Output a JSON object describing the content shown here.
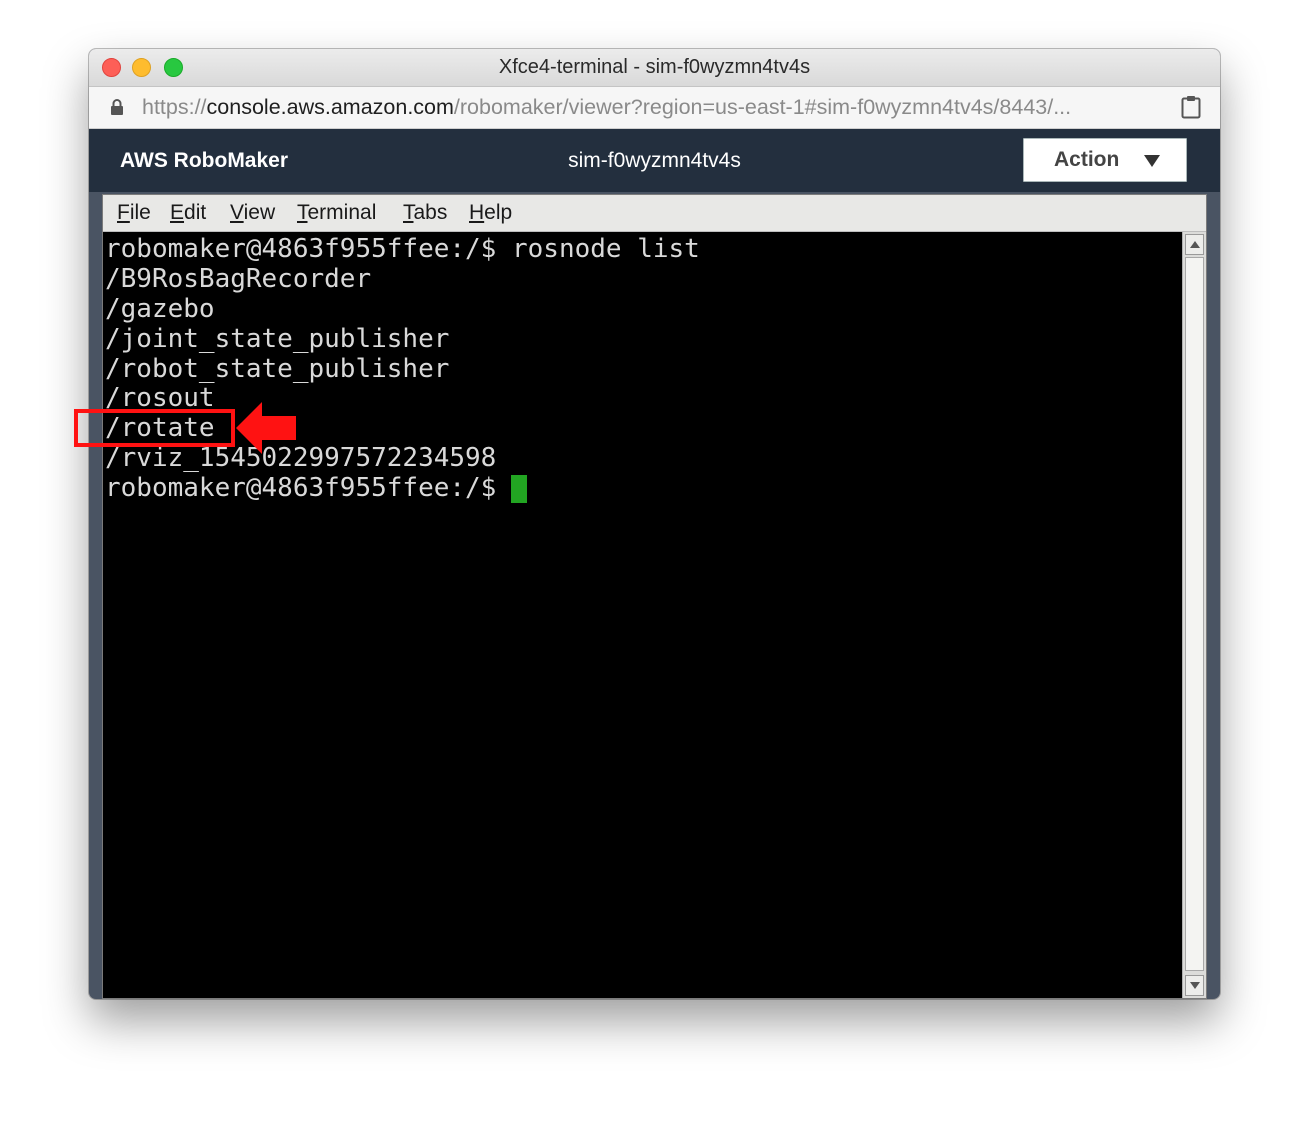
{
  "window": {
    "title": "Xfce4-terminal - sim-f0wyzmn4tv4s"
  },
  "address_bar": {
    "url_scheme": "https://",
    "url_host": "console.aws.amazon.com",
    "url_path": "/robomaker/viewer?region=us-east-1#sim-f0wyzmn4tv4s/8443/...",
    "icons": [
      "lock-icon",
      "clipboard-icon"
    ]
  },
  "app_header": {
    "brand": "AWS RoboMaker",
    "simulation_id": "sim-f0wyzmn4tv4s",
    "action_button": "Action",
    "action_caret_icon": "caret-down-icon"
  },
  "menubar": {
    "items": [
      {
        "first": "F",
        "rest": "ile"
      },
      {
        "first": "E",
        "rest": "dit"
      },
      {
        "first": "V",
        "rest": "iew"
      },
      {
        "first": "T",
        "rest": "erminal"
      },
      {
        "first": "T",
        "rest": "abs"
      },
      {
        "first": "H",
        "rest": "elp"
      }
    ]
  },
  "terminal": {
    "lines": [
      "robomaker@4863f955ffee:/$ rosnode list",
      "/B9RosBagRecorder",
      "/gazebo",
      "/joint_state_publisher",
      "/robot_state_publisher",
      "/rosout",
      "/rotate",
      "/rviz_1545022997572234598",
      "robomaker@4863f955ffee:/$ "
    ],
    "cursor_color": "#22a522",
    "text_color": "#d9d9d9",
    "background": "#000000"
  },
  "annotation": {
    "highlighted_line": "/rotate",
    "color": "#ff1212"
  }
}
